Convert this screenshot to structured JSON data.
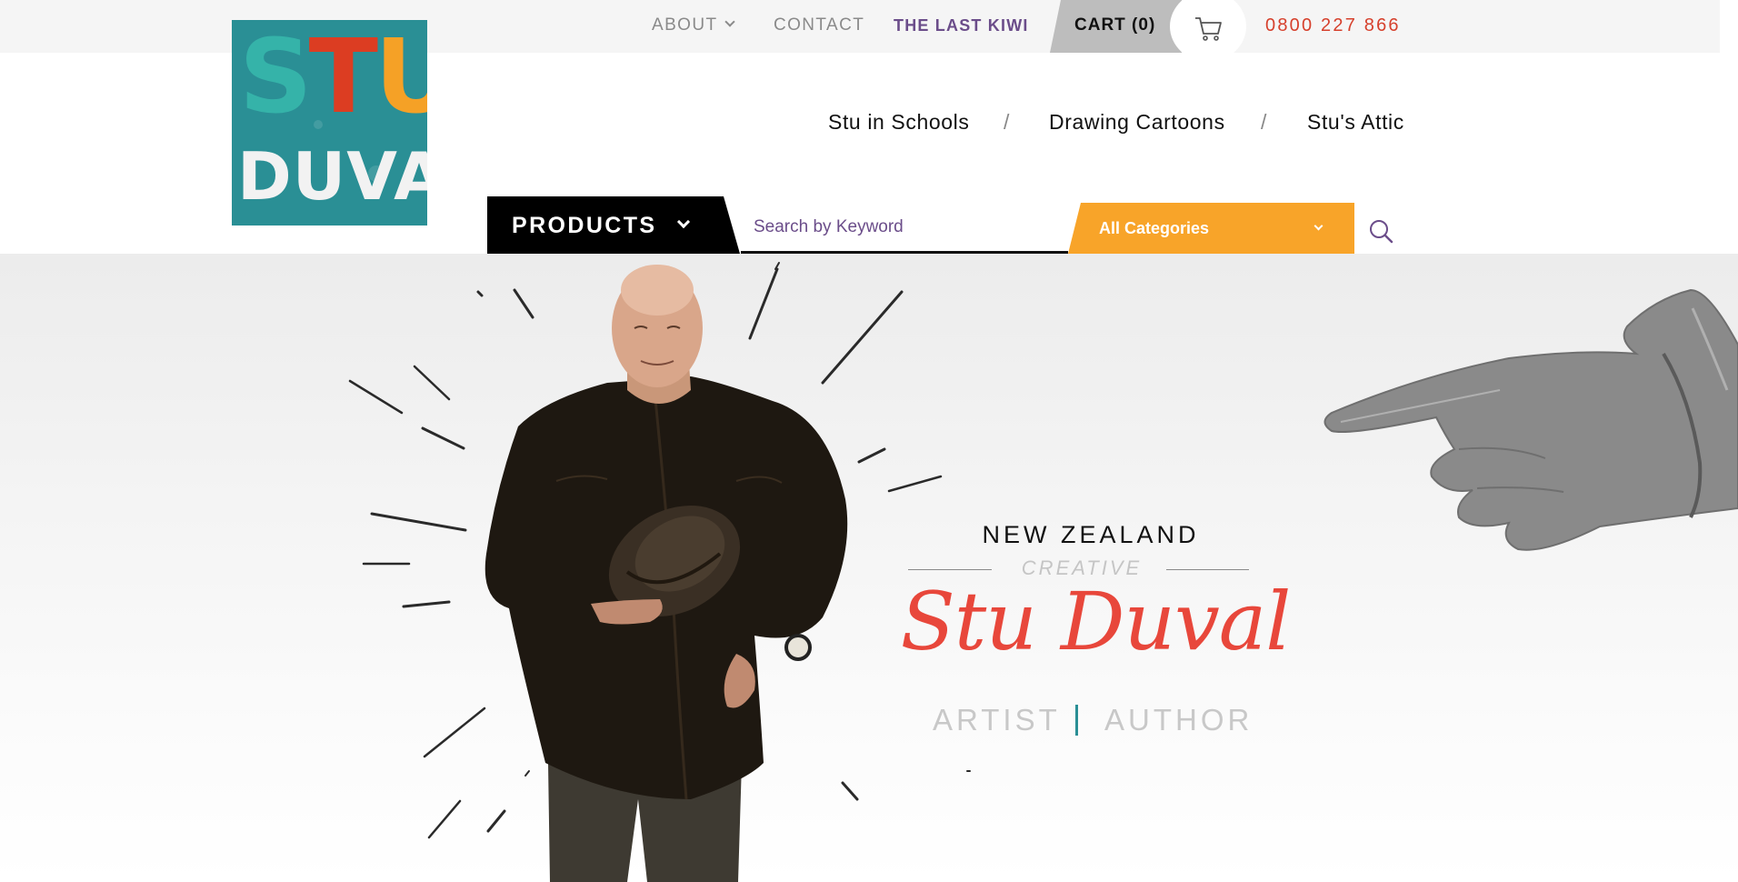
{
  "topnav": {
    "about": "ABOUT",
    "contact": "CONTACT",
    "last_kiwi": "THE LAST KIWI",
    "cart": "CART (0)",
    "phone": "0800 227 866"
  },
  "logo": {
    "line1": [
      "S",
      "T",
      "U"
    ],
    "line2": "DUVAL"
  },
  "mainnav": {
    "items": [
      "Stu in Schools",
      "Drawing Cartoons",
      "Stu's Attic"
    ],
    "separator": "/"
  },
  "search": {
    "products_label": "PRODUCTS",
    "placeholder": "Search by Keyword",
    "category": "All Categories"
  },
  "hero": {
    "country": "NEW ZEALAND",
    "creative": "CREATIVE",
    "name": "Stu Duval",
    "role1": "ARTIST",
    "role2": "AUTHOR"
  },
  "colors": {
    "accent_red": "#e8473b",
    "brand_teal": "#2a8f95",
    "category_orange": "#f8a429",
    "link_purple": "#6b4d8a"
  },
  "icons": [
    "chevron-down-icon",
    "cart-icon",
    "search-icon"
  ]
}
